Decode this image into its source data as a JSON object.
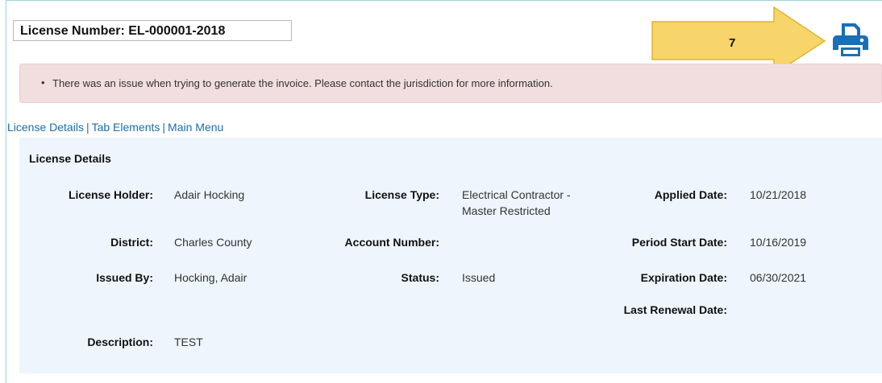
{
  "header": {
    "license_number": "License Number: EL-000001-2018"
  },
  "annotation": {
    "number": "7",
    "arrow_color": "#f7d56a",
    "arrow_border": "#e0b42b"
  },
  "print_icon": {
    "name": "printer-icon",
    "color": "#1a6fb5"
  },
  "alert": {
    "bullet": "•",
    "message": "There was an issue when trying to generate the invoice. Please contact the jurisdiction for more information."
  },
  "nav_links": {
    "license_details": "License Details",
    "separator": "|",
    "tab_elements": "Tab Elements",
    "main_menu": "Main Menu"
  },
  "details": {
    "title": "License Details",
    "license_holder_label": "License Holder:",
    "license_holder": "Adair Hocking",
    "license_type_label": "License Type:",
    "license_type_line1": "Electrical Contractor -",
    "license_type_line2": "Master Restricted",
    "applied_date_label": "Applied Date:",
    "applied_date": "10/21/2018",
    "district_label": "District:",
    "district": "Charles County",
    "account_number_label": "Account Number:",
    "account_number": "",
    "period_start_label": "Period Start Date:",
    "period_start": "10/16/2019",
    "issued_by_label": "Issued By:",
    "issued_by": "Hocking, Adair",
    "status_label": "Status:",
    "status": "Issued",
    "expiration_label": "Expiration Date:",
    "expiration": "06/30/2021",
    "last_renewal_label": "Last Renewal Date:",
    "last_renewal": "",
    "description_label": "Description:",
    "description": "TEST"
  }
}
